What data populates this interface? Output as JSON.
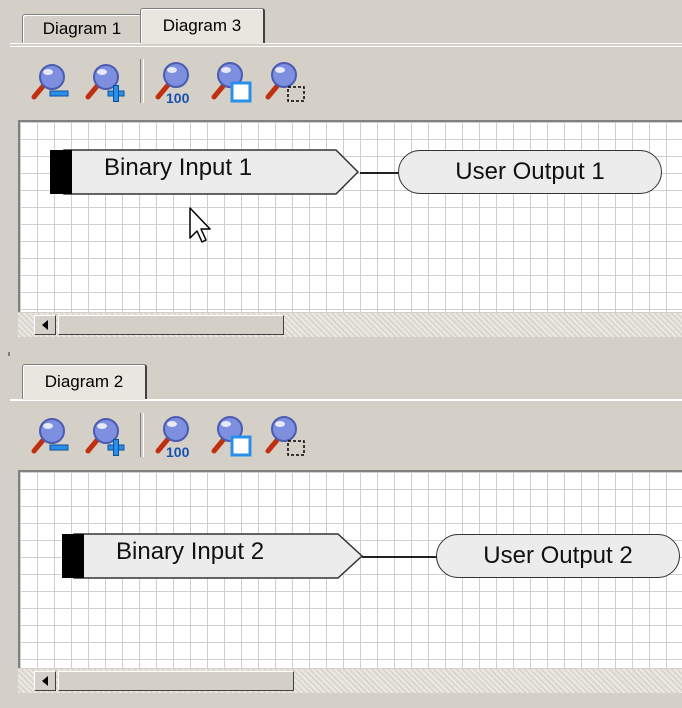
{
  "top_pane": {
    "tabs": [
      {
        "label": "Diagram 1",
        "active": false
      },
      {
        "label": "Diagram 3",
        "active": true
      }
    ],
    "toolbar": [
      "zoom-out-icon",
      "zoom-in-icon",
      "zoom-100-icon",
      "zoom-fit-icon",
      "zoom-selection-icon"
    ],
    "input_label": "Binary Input 1",
    "output_label": "User Output 1"
  },
  "bottom_pane": {
    "tabs": [
      {
        "label": "Diagram 2",
        "active": true
      }
    ],
    "toolbar": [
      "zoom-out-icon",
      "zoom-in-icon",
      "zoom-100-icon",
      "zoom-fit-icon",
      "zoom-selection-icon"
    ],
    "input_label": "Binary Input 2",
    "output_label": "User Output 2"
  },
  "colors": {
    "window_bg": "#d4d0c8",
    "canvas_bg": "#ffffff",
    "grid": "#cfcfcf",
    "node_fill": "#ececec",
    "input_marker": "#000000",
    "zoom_lens": "#7e8fe0",
    "plus_badge": "#2a8fe8"
  },
  "zoom_100_text": "100"
}
